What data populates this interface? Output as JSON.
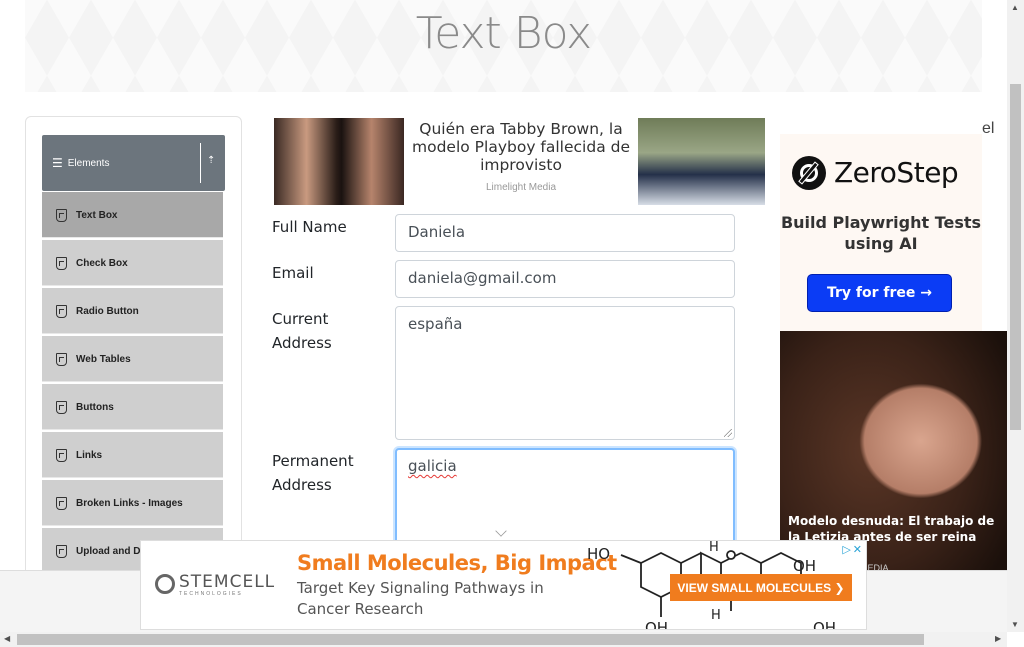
{
  "page": {
    "title": "Text Box"
  },
  "sidebar": {
    "group_label": "Elements",
    "items": [
      {
        "label": "Text Box",
        "active": true
      },
      {
        "label": "Check Box"
      },
      {
        "label": "Radio Button"
      },
      {
        "label": "Web Tables"
      },
      {
        "label": "Buttons"
      },
      {
        "label": "Links"
      },
      {
        "label": "Broken Links - Images"
      },
      {
        "label": "Upload and D"
      }
    ]
  },
  "ad_top": {
    "headline": "Quién era Tabby Brown, la modelo Playboy fallecida de improvisto",
    "source": "Limelight Media"
  },
  "form": {
    "full_name": {
      "label": "Full Name",
      "value": "Daniela"
    },
    "email": {
      "label": "Email",
      "value": "daniela@gmail.com"
    },
    "current_address": {
      "label": "Current Address",
      "value": "españa"
    },
    "permanent_address": {
      "label": "Permanent Address",
      "value": "galicia"
    }
  },
  "ad_right": {
    "brand": "ZeroStep",
    "tagline": "Build Playwright Tests using AI",
    "cta": "Try for free →",
    "corner_text": "el",
    "photo_caption": "Modelo desnuda: El trabajo de la Letizia antes de ser reina",
    "photo_source": "MEDIA"
  },
  "ad_bottom": {
    "brand": "STEMCELL",
    "brand_sub": "TECHNOLOGIES",
    "headline": "Small Molecules, Big Impact",
    "body_line1": "Target Key Signaling Pathways in",
    "body_line2": "Cancer Research",
    "cta": "VIEW SMALL MOLECULES ❯",
    "molecule_labels": [
      "HO",
      "OH",
      "OH",
      "OH",
      "H",
      "H"
    ]
  },
  "colors": {
    "accent": "#0b3cf5",
    "orange": "#f07c1e",
    "sidebar_header": "#6c757d",
    "focus": "#80bdff"
  }
}
